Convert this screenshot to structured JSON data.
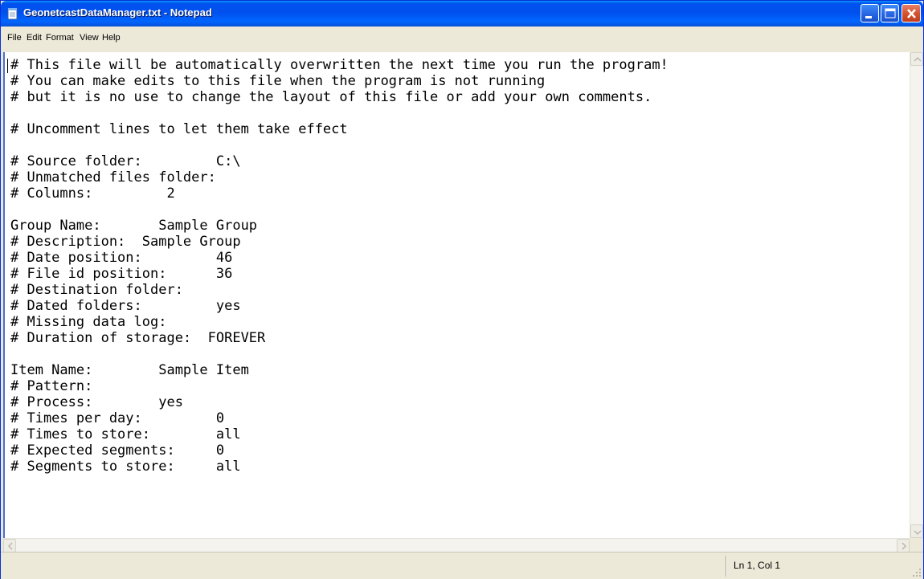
{
  "window": {
    "title": "GeonetcastDataManager.txt - Notepad",
    "icon": "notepad-icon"
  },
  "menu": {
    "file": "File",
    "edit": "Edit",
    "format": "Format",
    "view": "View",
    "help": "Help"
  },
  "editor": {
    "lines": [
      "# This file will be automatically overwritten the next time you run the program!",
      "# You can make edits to this file when the program is not running",
      "# but it is no use to change the layout of this file or add your own comments.",
      "",
      "# Uncomment lines to let them take effect",
      "",
      "# Source folder:         C:\\",
      "# Unmatched files folder:",
      "# Columns:         2",
      "",
      "Group Name:       Sample Group",
      "# Description:  Sample Group",
      "# Date position:         46",
      "# File id position:      36",
      "# Destination folder:",
      "# Dated folders:         yes",
      "# Missing data log:",
      "# Duration of storage:  FOREVER",
      "",
      "Item Name:        Sample Item",
      "# Pattern:",
      "# Process:        yes",
      "# Times per day:         0",
      "# Times to store:        all",
      "# Expected segments:     0",
      "# Segments to store:     all"
    ]
  },
  "status": {
    "position": "Ln 1, Col 1"
  },
  "colors": {
    "titlebar": "#0054e3",
    "window_face": "#ece9d8",
    "close_button": "#d4542f"
  }
}
